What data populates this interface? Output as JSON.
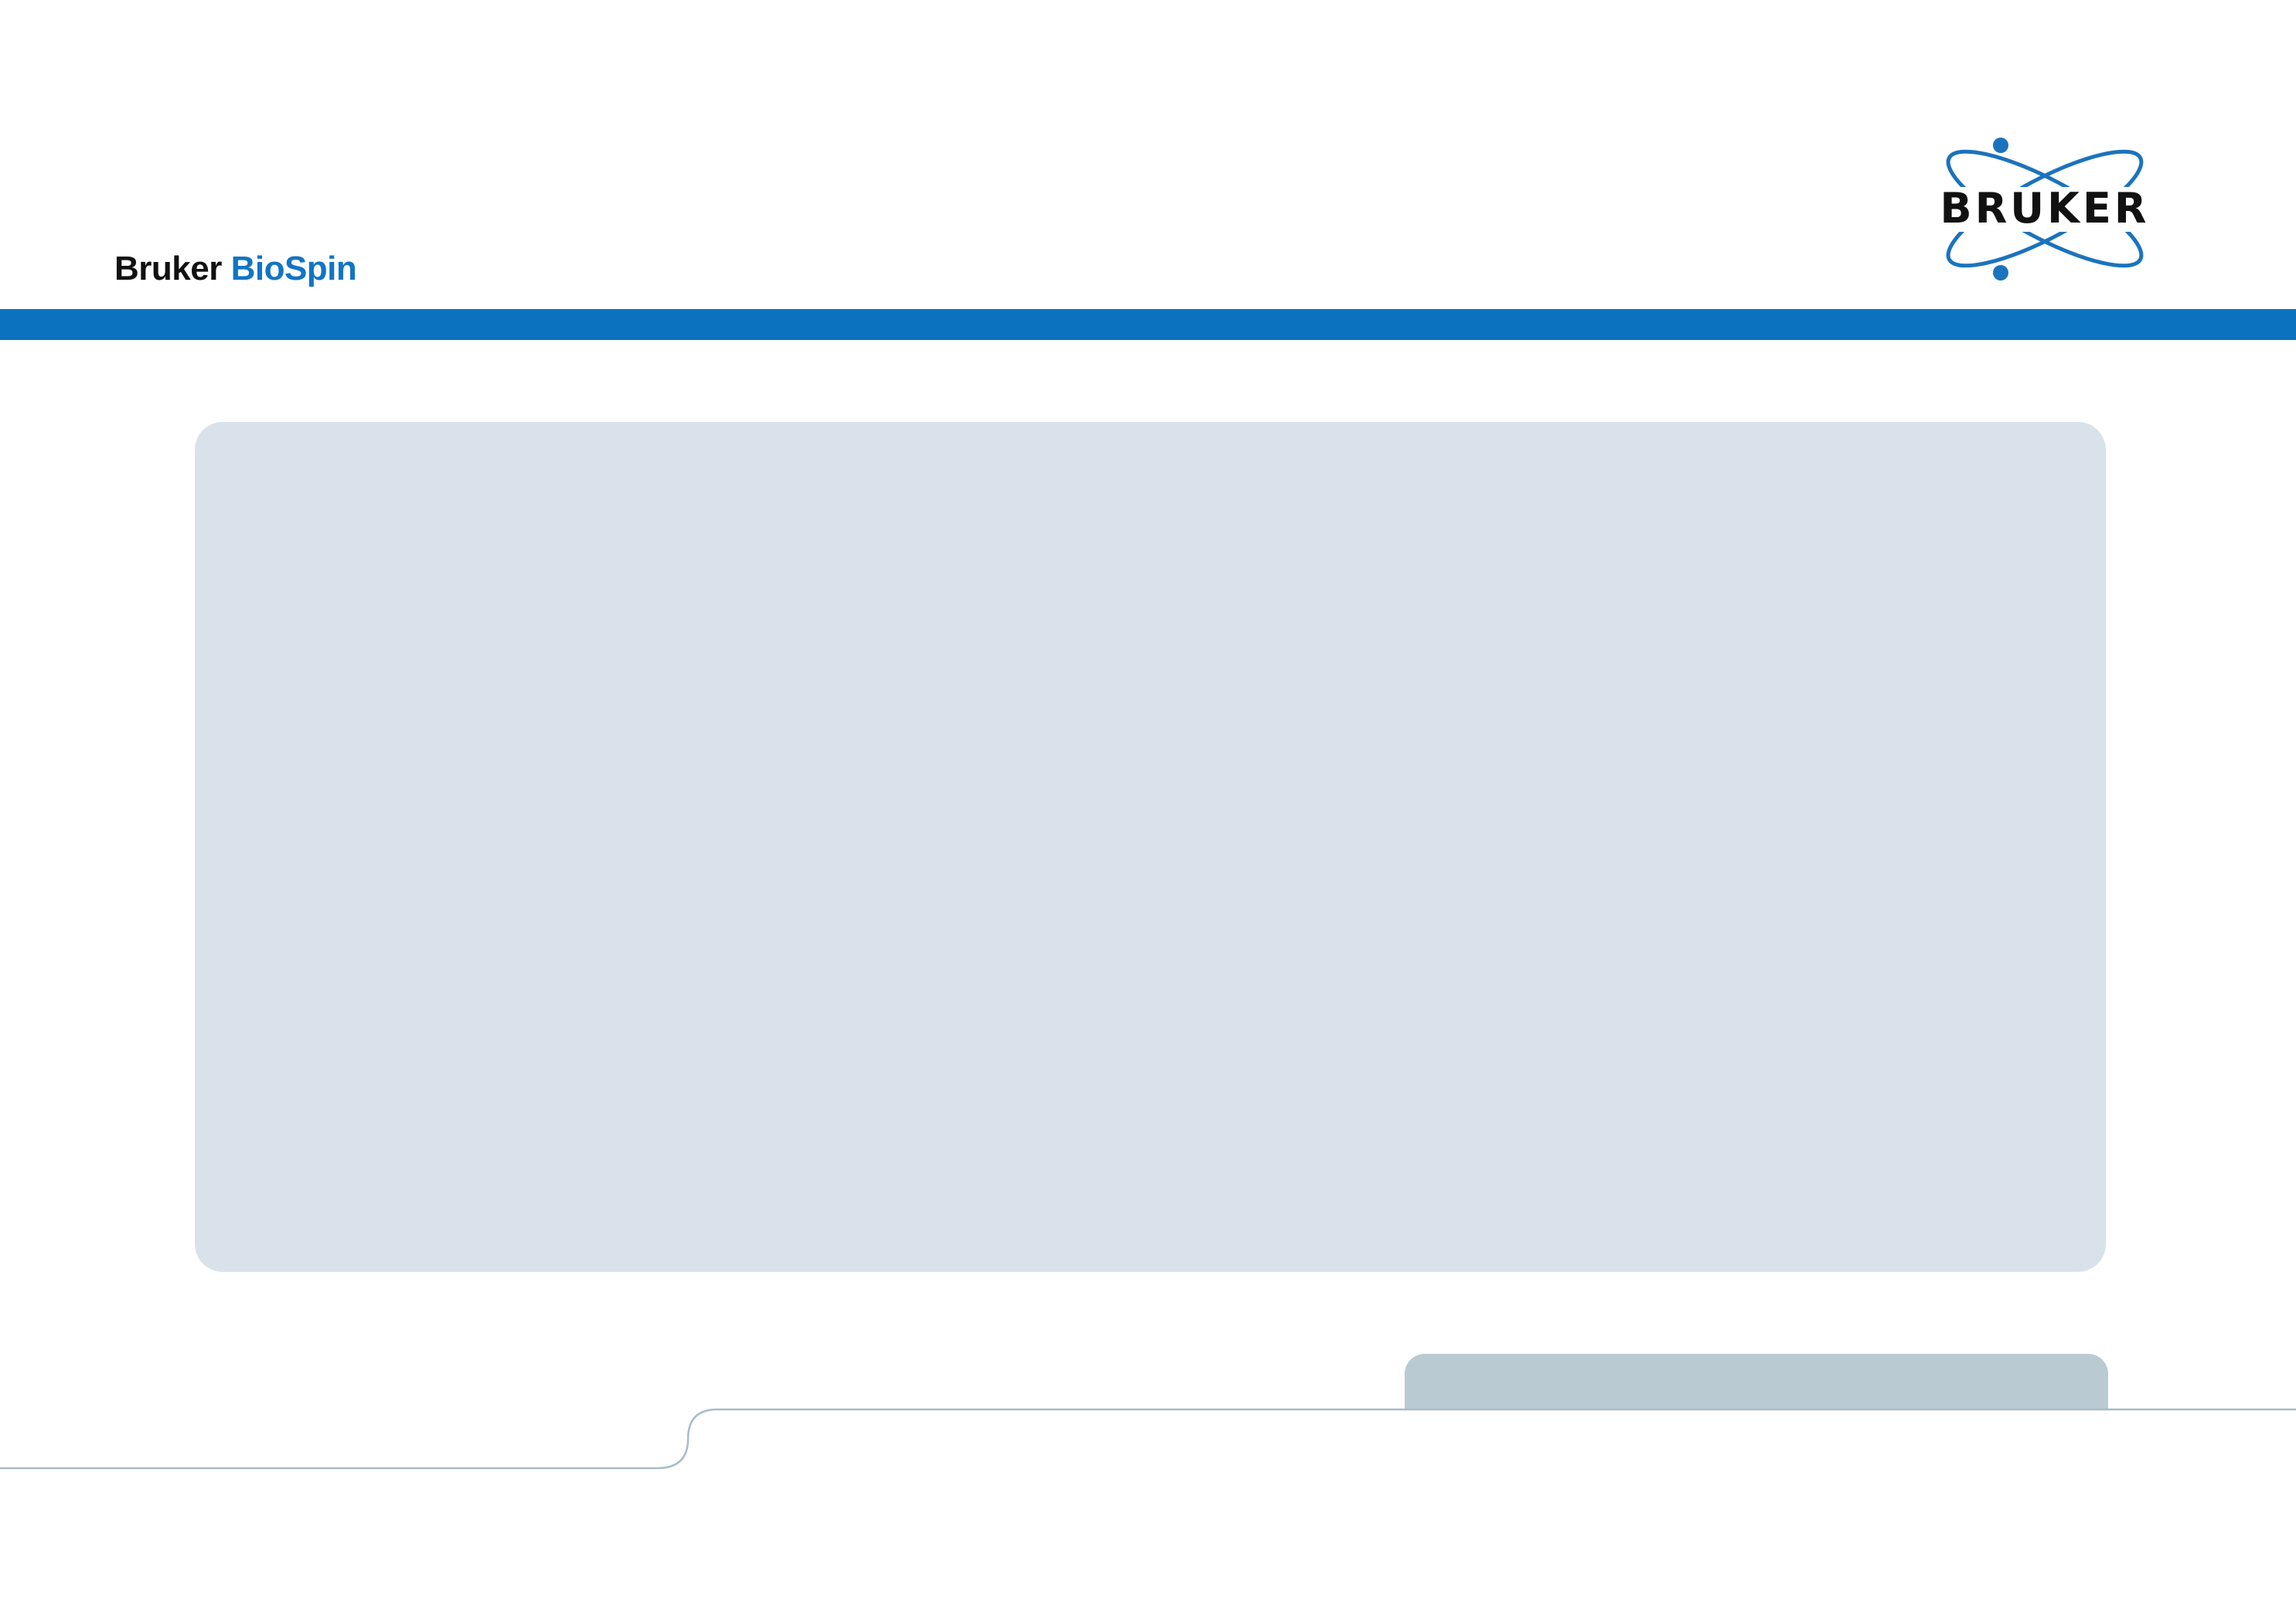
{
  "header": {
    "brand_company": "Bruker",
    "brand_division": "BioSpin",
    "logo_label": "BRUKER"
  },
  "colors": {
    "accent_blue": "#0a72bf",
    "brand_text_blue": "#1274c4",
    "panel_bg": "#d9e2ea",
    "footer_tab_bg": "#b9cad2",
    "footer_line": "#a9bcc8"
  }
}
